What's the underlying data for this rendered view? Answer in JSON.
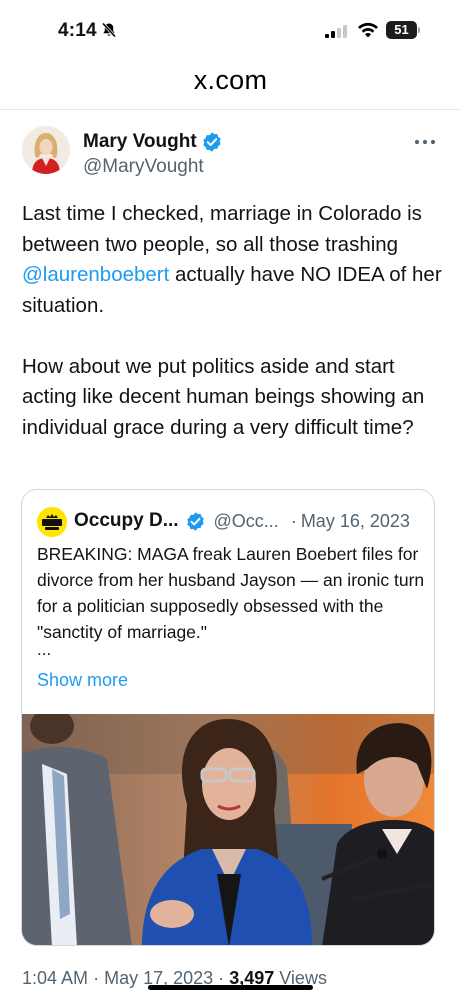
{
  "status_bar": {
    "time": "4:14",
    "battery": "51"
  },
  "browser": {
    "url": "x.com"
  },
  "tweet": {
    "author_name": "Mary Vought",
    "author_handle": "@MaryVought",
    "text_part1": "Last time I checked, marriage in Colorado is between two people, so all those trashing ",
    "mention": "@laurenboebert",
    "text_part2": " actually have NO IDEA of her situation.",
    "text_para2": "How about we put politics aside and start acting like decent human beings showing an individual grace during a very difficult time?",
    "time": "1:04 AM",
    "date": "May 17, 2023",
    "views_count": "3,497",
    "views_label": "Views",
    "separator": "·"
  },
  "quoted_tweet": {
    "author_name": "Occupy D...",
    "author_handle": "@Occ...",
    "separator": "·",
    "date": "May 16, 2023",
    "text": "BREAKING: MAGA freak Lauren Boebert files for divorce from her husband Jayson — an ironic turn for a politician supposedly obsessed with the \"sanctity of marriage.\"",
    "ellipsis": "...",
    "show_more": "Show more",
    "avatar_text": "OCCUPY DEMOCRATS"
  },
  "colors": {
    "link": "#1d9bf0",
    "verified": "#1d9bf0",
    "secondary_text": "#536471"
  },
  "icons": [
    "bell-off-icon",
    "signal-icon",
    "wifi-icon",
    "battery-icon",
    "verified-badge-icon",
    "more-icon"
  ]
}
